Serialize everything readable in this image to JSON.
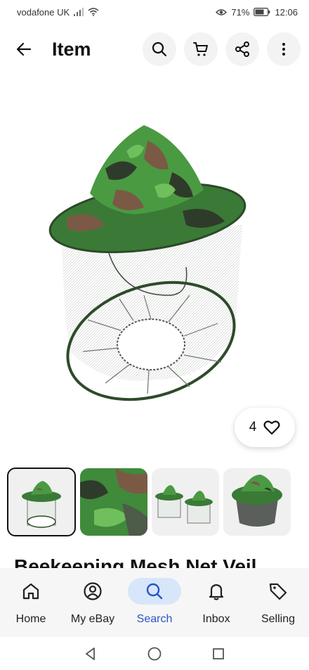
{
  "status": {
    "carrier": "vodafone UK",
    "battery": "71%",
    "time": "12:06"
  },
  "appbar": {
    "title": "Item"
  },
  "item": {
    "likes": "4",
    "title": "Beekeeping Mesh Net Veil"
  },
  "nav": [
    {
      "label": "Home",
      "icon": "home-icon"
    },
    {
      "label": "My eBay",
      "icon": "user-icon"
    },
    {
      "label": "Search",
      "icon": "search-icon"
    },
    {
      "label": "Inbox",
      "icon": "bell-icon"
    },
    {
      "label": "Selling",
      "icon": "tag-icon"
    }
  ],
  "colors": {
    "accent": "#2756c9",
    "active_nav_bg": "#d8e6fa",
    "camo_green": "#3c8f3a",
    "camo_dark": "#2f3b2a",
    "camo_brown": "#7a5a45"
  }
}
